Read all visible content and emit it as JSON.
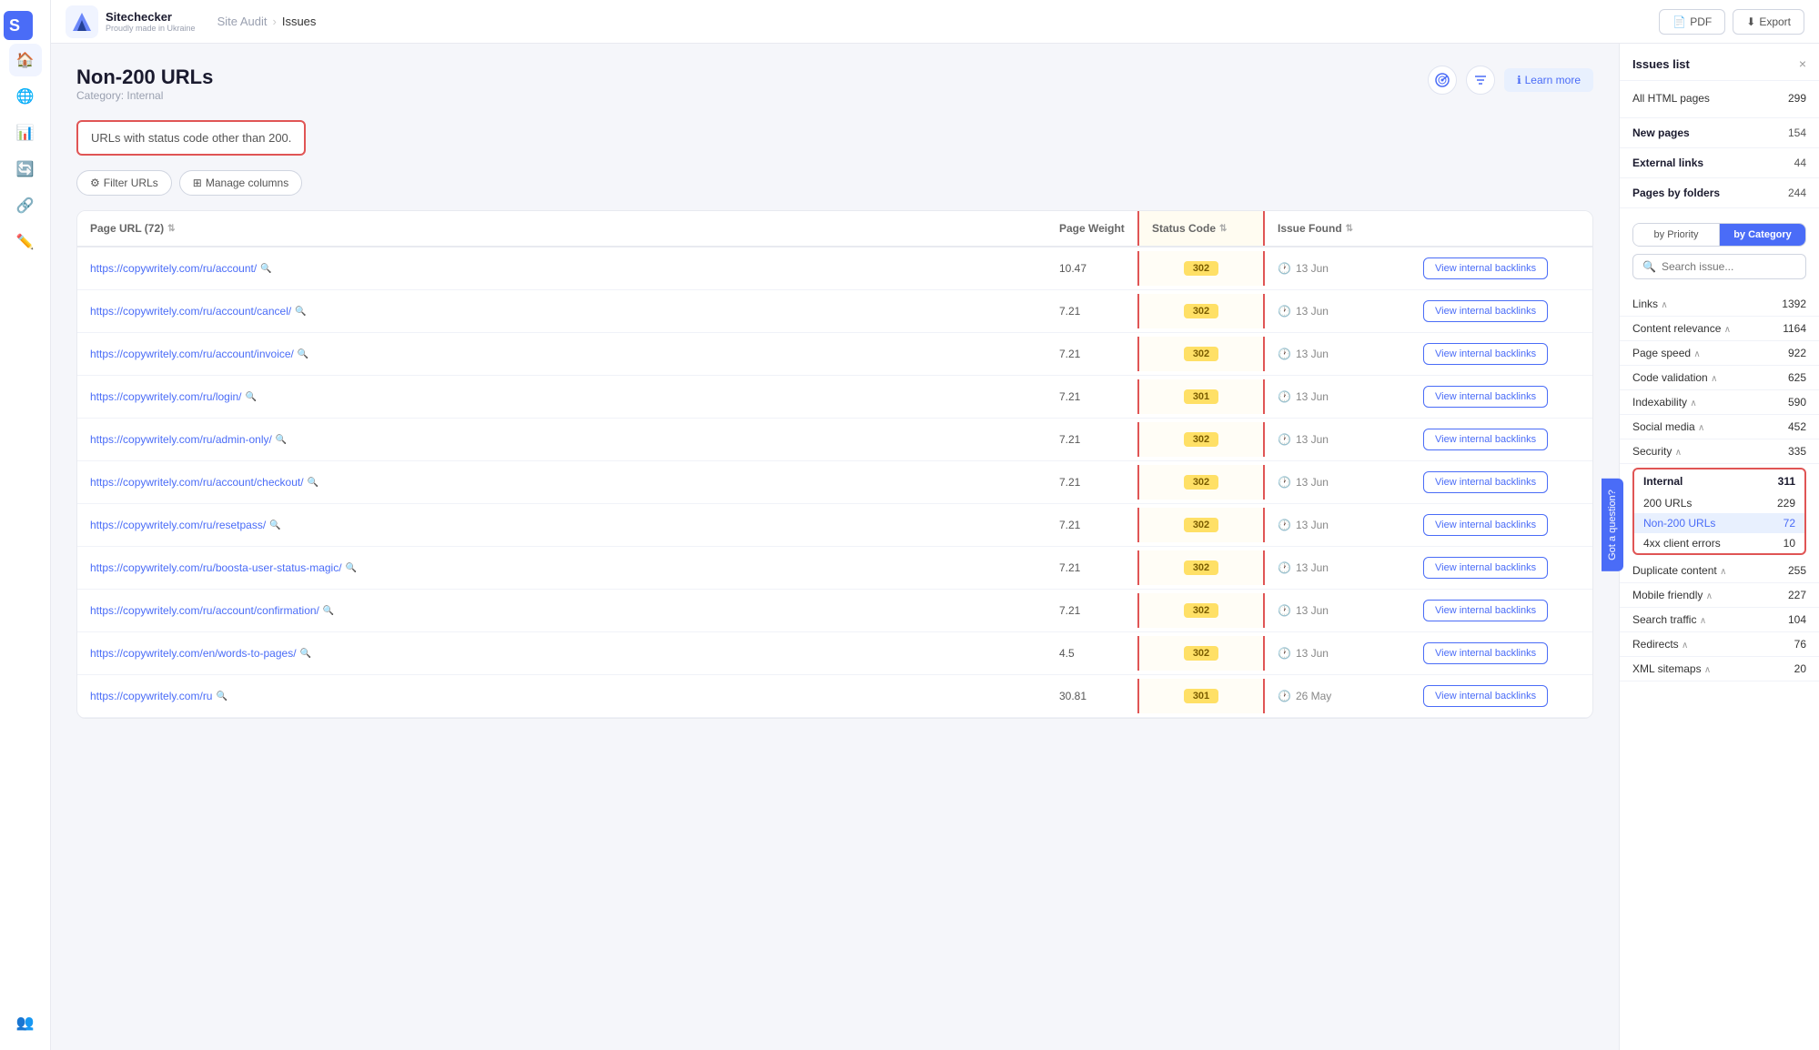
{
  "app": {
    "name": "Sitechecker",
    "subtitle": "Proudly made in Ukraine"
  },
  "header": {
    "breadcrumb_parent": "Site Audit",
    "breadcrumb_current": "Issues",
    "btn_pdf": "PDF",
    "btn_export": "Export"
  },
  "page": {
    "title": "Non-200 URLs",
    "category": "Category: Internal",
    "description": "URLs with status code other than 200.",
    "learn_more": "Learn more",
    "filter_btn": "Filter URLs",
    "manage_columns_btn": "Manage columns"
  },
  "table": {
    "columns": [
      "Page URL (72)",
      "Page Weight",
      "Status Code",
      "Issue Found",
      ""
    ],
    "rows": [
      {
        "url": "https://copywritely.com/ru/account/",
        "weight": "10.47",
        "status": "302",
        "date": "13 Jun",
        "action": "View internal backlinks"
      },
      {
        "url": "https://copywritely.com/ru/account/cancel/",
        "weight": "7.21",
        "status": "302",
        "date": "13 Jun",
        "action": "View internal backlinks"
      },
      {
        "url": "https://copywritely.com/ru/account/invoice/",
        "weight": "7.21",
        "status": "302",
        "date": "13 Jun",
        "action": "View internal backlinks"
      },
      {
        "url": "https://copywritely.com/ru/login/",
        "weight": "7.21",
        "status": "301",
        "date": "13 Jun",
        "action": "View internal backlinks"
      },
      {
        "url": "https://copywritely.com/ru/admin-only/",
        "weight": "7.21",
        "status": "302",
        "date": "13 Jun",
        "action": "View internal backlinks"
      },
      {
        "url": "https://copywritely.com/ru/account/checkout/",
        "weight": "7.21",
        "status": "302",
        "date": "13 Jun",
        "action": "View internal backlinks"
      },
      {
        "url": "https://copywritely.com/ru/resetpass/",
        "weight": "7.21",
        "status": "302",
        "date": "13 Jun",
        "action": "View internal backlinks"
      },
      {
        "url": "https://copywritely.com/ru/boosta-user-status-magic/",
        "weight": "7.21",
        "status": "302",
        "date": "13 Jun",
        "action": "View internal backlinks"
      },
      {
        "url": "https://copywritely.com/ru/account/confirmation/",
        "weight": "7.21",
        "status": "302",
        "date": "13 Jun",
        "action": "View internal backlinks"
      },
      {
        "url": "https://copywritely.com/en/words-to-pages/",
        "weight": "4.5",
        "status": "302",
        "date": "13 Jun",
        "action": "View internal backlinks"
      },
      {
        "url": "https://copywritely.com/ru",
        "weight": "30.81",
        "status": "301",
        "date": "26 May",
        "action": "View internal backlinks"
      }
    ]
  },
  "sidebar": {
    "title": "Issues list",
    "close_label": "×",
    "all_html_pages": {
      "label": "All HTML pages",
      "count": "299"
    },
    "new_pages": {
      "label": "New pages",
      "count": "154"
    },
    "external_links": {
      "label": "External links",
      "count": "44"
    },
    "pages_by_folders": {
      "label": "Pages by folders",
      "count": "244"
    },
    "priority_tab1": "by Priority",
    "priority_tab2": "by Category",
    "search_placeholder": "Search issue...",
    "categories": [
      {
        "label": "Links",
        "count": "1392",
        "collapsed": false
      },
      {
        "label": "Content relevance",
        "count": "1164",
        "collapsed": false
      },
      {
        "label": "Page speed",
        "count": "922",
        "collapsed": false
      },
      {
        "label": "Code validation",
        "count": "625",
        "collapsed": false
      },
      {
        "label": "Indexability",
        "count": "590",
        "collapsed": false
      },
      {
        "label": "Social media",
        "count": "452",
        "collapsed": false
      },
      {
        "label": "Security",
        "count": "335",
        "collapsed": false
      }
    ],
    "internal": {
      "label": "Internal",
      "count": "311",
      "items": [
        {
          "label": "200 URLs",
          "count": "229"
        },
        {
          "label": "Non-200 URLs",
          "count": "72",
          "active": true
        },
        {
          "label": "4xx client errors",
          "count": "10"
        }
      ]
    },
    "bottom_categories": [
      {
        "label": "Duplicate content",
        "count": "255"
      },
      {
        "label": "Mobile friendly",
        "count": "227"
      },
      {
        "label": "Search traffic",
        "count": "104"
      },
      {
        "label": "Redirects",
        "count": "76"
      },
      {
        "label": "XML sitemaps",
        "count": "20"
      }
    ]
  },
  "nav": {
    "items": [
      "🏠",
      "🌐",
      "📊",
      "🔄",
      "🔗",
      "✏️",
      "👥"
    ]
  },
  "got_question": "Got a question?"
}
